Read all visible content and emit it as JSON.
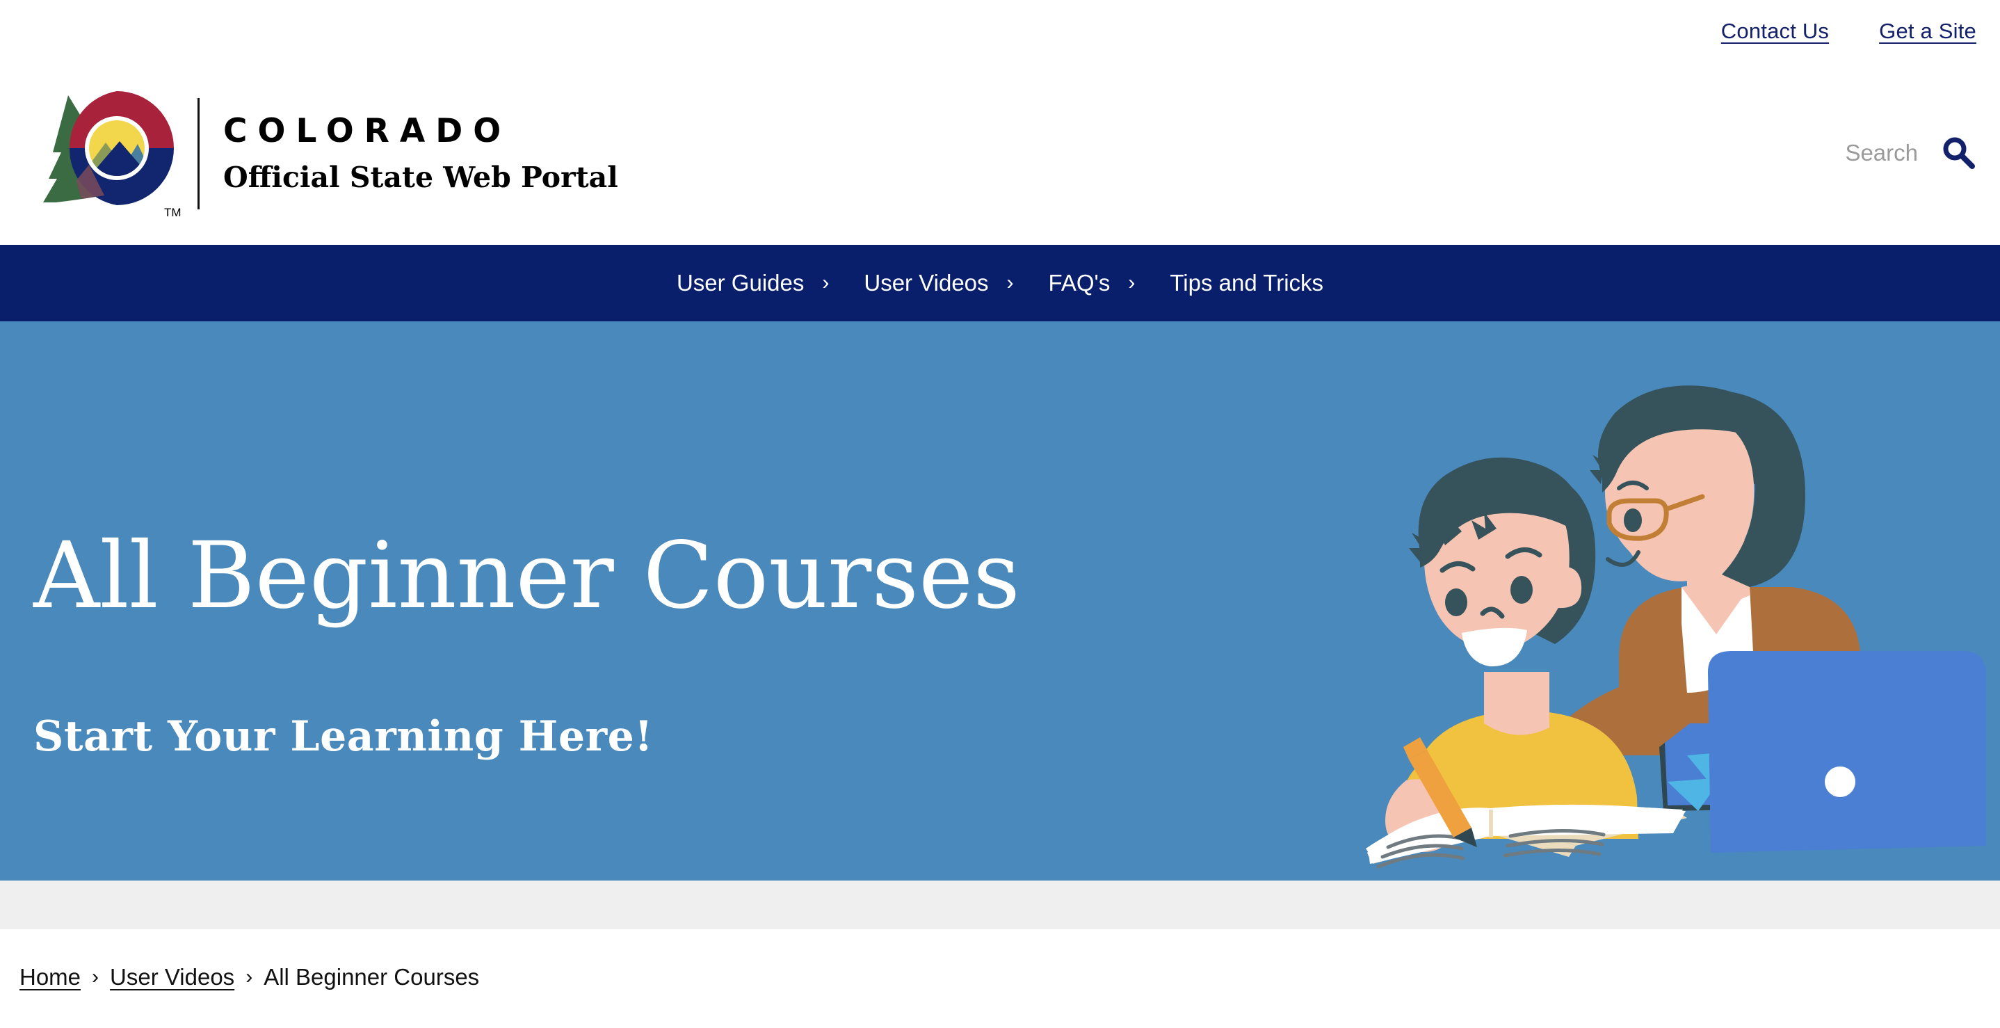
{
  "utility": {
    "links": [
      {
        "label": "Contact Us",
        "name": "contact-us-link"
      },
      {
        "label": "Get a Site",
        "name": "get-a-site-link"
      }
    ]
  },
  "brand": {
    "title": "COLORADO",
    "subtitle": "Official State Web Portal",
    "trademark": "TM",
    "logo_colors": {
      "tree_green": "#3b6b42",
      "c_red": "#a8223c",
      "c_navy": "#11266e",
      "circle_yellow": "#f2d64b",
      "mountain_blue": "#4a7fa0",
      "mountain_olive": "#8a9b57"
    }
  },
  "search": {
    "placeholder": "Search",
    "value": "",
    "icon": "search-icon",
    "icon_color": "#13216b"
  },
  "nav": {
    "background": "#0a1f6b",
    "items": [
      {
        "label": "User Guides",
        "has_chevron": true,
        "chevron": "›"
      },
      {
        "label": "User Videos",
        "has_chevron": true,
        "chevron": "›"
      },
      {
        "label": "FAQ's",
        "has_chevron": true,
        "chevron": "›"
      },
      {
        "label": "Tips and Tricks",
        "has_chevron": false,
        "chevron": ""
      }
    ]
  },
  "hero": {
    "title": "All Beginner Courses",
    "subtitle": "Start Your Learning Here!",
    "background": "#4a89bb",
    "illustration": {
      "name": "student-and-tutor-illustration",
      "colors": {
        "hair": "#36535c",
        "skin": "#f5c4b2",
        "child_shirt": "#f0c23f",
        "adult_cardigan": "#ad6f3c",
        "adult_top": "#ffffff",
        "glasses": "#c07f35",
        "laptop_lid": "#4a7fd4",
        "laptop_base": "#2f4750",
        "laptop_accent": "#4fb5e5",
        "book_page": "#ffffff",
        "book_edge": "#eadcbc",
        "book_lines": "#6f7b80",
        "pencil": "#f0a13f",
        "pencil_tip": "#2f4750"
      }
    }
  },
  "breadcrumb": {
    "items": [
      {
        "label": "Home",
        "link": true
      },
      {
        "label": "User Videos",
        "link": true
      },
      {
        "label": "All Beginner Courses",
        "link": false
      }
    ],
    "separator": "›"
  }
}
